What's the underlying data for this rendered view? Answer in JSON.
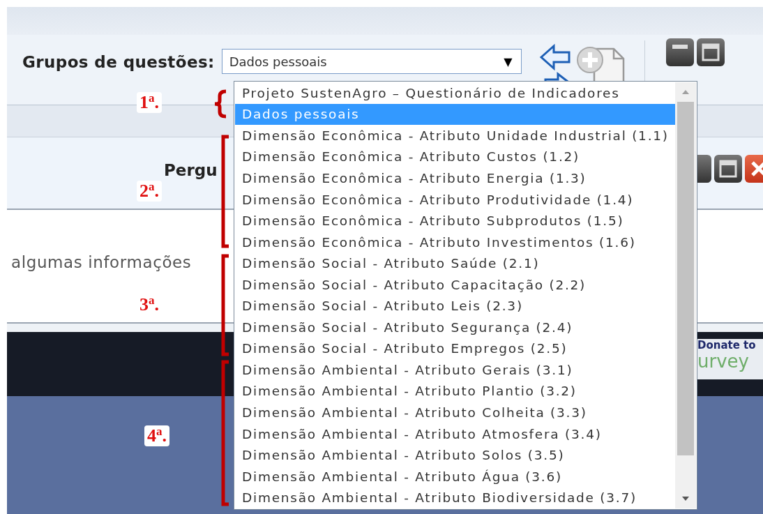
{
  "toolbar": {
    "label": "Grupos de questões:",
    "select": {
      "value": "Dados pessoais",
      "caret": "▼"
    }
  },
  "question_header": {
    "title": "Pergu"
  },
  "question_text": "algumas informações",
  "banner": {
    "line_1": "Donate to",
    "line_2": "urvey"
  },
  "dropdown": {
    "items": [
      {
        "label": "Projeto SustenAgro – Questionário de Indicadores",
        "selected": false
      },
      {
        "label": "Dados pessoais",
        "selected": true
      },
      {
        "label": "Dimensão Econômica - Atributo Unidade Industrial (1.1)",
        "selected": false
      },
      {
        "label": "Dimensão Econômica - Atributo Custos (1.2)",
        "selected": false
      },
      {
        "label": "Dimensão Econômica - Atributo Energia (1.3)",
        "selected": false
      },
      {
        "label": "Dimensão Econômica - Atributo Produtividade (1.4)",
        "selected": false
      },
      {
        "label": "Dimensão Econômica - Atributo Subprodutos (1.5)",
        "selected": false
      },
      {
        "label": "Dimensão Econômica - Atributo Investimentos (1.6)",
        "selected": false
      },
      {
        "label": "Dimensão Social - Atributo Saúde (2.1)",
        "selected": false
      },
      {
        "label": "Dimensão Social - Atributo Capacitação (2.2)",
        "selected": false
      },
      {
        "label": "Dimensão Social - Atributo Leis (2.3)",
        "selected": false
      },
      {
        "label": "Dimensão Social - Atributo Segurança (2.4)",
        "selected": false
      },
      {
        "label": "Dimensão Social - Atributo Empregos (2.5)",
        "selected": false
      },
      {
        "label": "Dimensão Ambiental - Atributo Gerais (3.1)",
        "selected": false
      },
      {
        "label": "Dimensão Ambiental - Atributo Plantio (3.2)",
        "selected": false
      },
      {
        "label": "Dimensão Ambiental - Atributo Colheita (3.3)",
        "selected": false
      },
      {
        "label": "Dimensão Ambiental - Atributo Atmosfera (3.4)",
        "selected": false
      },
      {
        "label": "Dimensão Ambiental - Atributo Solos (3.5)",
        "selected": false
      },
      {
        "label": "Dimensão Ambiental - Atributo Água (3.6)",
        "selected": false
      },
      {
        "label": "Dimensão Ambiental - Atributo Biodiversidade (3.7)",
        "selected": false
      }
    ]
  },
  "annotations": [
    {
      "label": "1$^{a}$.",
      "kind": "brace"
    },
    {
      "label": "2$^{a}$.",
      "kind": "bracket"
    },
    {
      "label": "3$^{a}$.",
      "kind": "bracket"
    },
    {
      "label": "4$^{a}$.",
      "kind": "bracket"
    }
  ]
}
